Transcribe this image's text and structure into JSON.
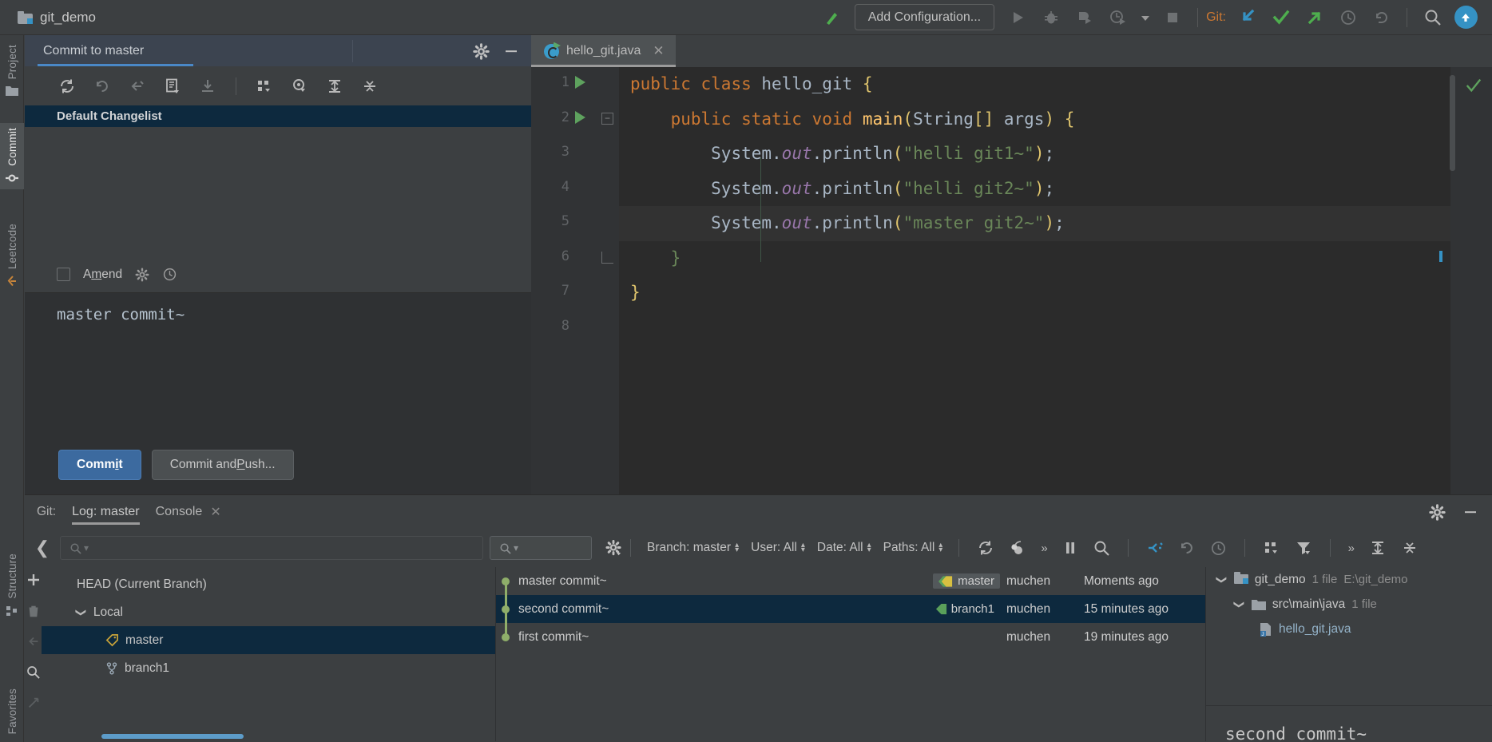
{
  "titlebar": {
    "project_name": "git_demo",
    "project_icon": "folder-module-icon",
    "run_config_label": "Add Configuration...",
    "git_label": "Git:",
    "icons": [
      {
        "name": "build-hammer-icon"
      },
      {
        "name": "run-icon"
      },
      {
        "name": "debug-icon"
      },
      {
        "name": "run-with-coverage-icon"
      },
      {
        "name": "profiler-icon"
      },
      {
        "name": "dropdown-caret-icon"
      },
      {
        "name": "stop-icon"
      },
      {
        "name": "git-update-project-icon"
      },
      {
        "name": "git-commit-icon"
      },
      {
        "name": "git-push-icon"
      },
      {
        "name": "git-history-icon"
      },
      {
        "name": "git-rollback-icon"
      },
      {
        "name": "search-everywhere-icon"
      },
      {
        "name": "ide-update-icon"
      }
    ]
  },
  "left_stripe": {
    "tabs": [
      {
        "label": "Project",
        "icon": "project-folder-icon",
        "selected": false
      },
      {
        "label": "Commit",
        "icon": "commit-icon",
        "selected": true
      },
      {
        "label": "Leetcode",
        "icon": "leetcode-icon",
        "selected": false
      }
    ],
    "bottom_tabs": [
      {
        "label": "Structure",
        "icon": "structure-icon",
        "selected": false
      },
      {
        "label": "Favorites",
        "icon": "favorites-icon",
        "selected": false
      }
    ]
  },
  "commit_window": {
    "title": "Commit to master",
    "settings_icon": "gear-icon",
    "minimize_icon": "minimize-icon",
    "toolbar_icons": [
      {
        "name": "refresh-changes-icon"
      },
      {
        "name": "rollback-icon"
      },
      {
        "name": "move-to-another-changelist-icon"
      },
      {
        "name": "show-diff-icon"
      },
      {
        "name": "shelve-changes-icon"
      },
      {
        "name": "group-by-icon"
      },
      {
        "name": "preview-diff-icon"
      },
      {
        "name": "expand-all-icon"
      },
      {
        "name": "collapse-all-icon"
      }
    ],
    "changelist_name": "Default Changelist",
    "amend_label": "Amend",
    "amend_checked": false,
    "amend_gear_icon": "gear-icon",
    "amend_history_icon": "history-icon",
    "commit_message": "master commit~",
    "commit_button": "Commit",
    "commit_push_button": "Commit and Push..."
  },
  "editor": {
    "tab": {
      "filename": "hello_git.java",
      "icon": "java-class-icon",
      "close_icon": "close-icon"
    },
    "inspection_status_icon": "inspections-ok-icon",
    "lines": [
      {
        "n": "1",
        "run": true,
        "fold": false,
        "highlight": false,
        "tokens": [
          {
            "t": "public ",
            "c": "k"
          },
          {
            "t": "class ",
            "c": "k"
          },
          {
            "t": "hello_git ",
            "c": "cls"
          },
          {
            "t": "{",
            "c": "br"
          }
        ]
      },
      {
        "n": "2",
        "run": true,
        "fold": true,
        "highlight": false,
        "tokens": [
          {
            "t": "    ",
            "c": "p"
          },
          {
            "t": "public ",
            "c": "k"
          },
          {
            "t": "static ",
            "c": "k"
          },
          {
            "t": "void ",
            "c": "k"
          },
          {
            "t": "main",
            "c": "mth"
          },
          {
            "t": "(",
            "c": "br"
          },
          {
            "t": "String",
            "c": "cls"
          },
          {
            "t": "[]",
            "c": "br"
          },
          {
            "t": " args",
            "c": "cls"
          },
          {
            "t": ")",
            "c": "br"
          },
          {
            "t": " {",
            "c": "br"
          }
        ]
      },
      {
        "n": "3",
        "run": false,
        "fold": false,
        "highlight": false,
        "tokens": [
          {
            "t": "        ",
            "c": "p"
          },
          {
            "t": "System",
            "c": "cls"
          },
          {
            "t": ".",
            "c": "p"
          },
          {
            "t": "out",
            "c": "fld"
          },
          {
            "t": ".",
            "c": "p"
          },
          {
            "t": "println",
            "c": "cls"
          },
          {
            "t": "(",
            "c": "br"
          },
          {
            "t": "\"helli git1~\"",
            "c": "s"
          },
          {
            "t": ")",
            "c": "br"
          },
          {
            "t": ";",
            "c": "p"
          }
        ]
      },
      {
        "n": "4",
        "run": false,
        "fold": false,
        "highlight": false,
        "tokens": [
          {
            "t": "        ",
            "c": "p"
          },
          {
            "t": "System",
            "c": "cls"
          },
          {
            "t": ".",
            "c": "p"
          },
          {
            "t": "out",
            "c": "fld"
          },
          {
            "t": ".",
            "c": "p"
          },
          {
            "t": "println",
            "c": "cls"
          },
          {
            "t": "(",
            "c": "br"
          },
          {
            "t": "\"helli git2~\"",
            "c": "s"
          },
          {
            "t": ")",
            "c": "br"
          },
          {
            "t": ";",
            "c": "p"
          }
        ]
      },
      {
        "n": "5",
        "run": false,
        "fold": false,
        "highlight": true,
        "tokens": [
          {
            "t": "        ",
            "c": "p"
          },
          {
            "t": "System",
            "c": "cls"
          },
          {
            "t": ".",
            "c": "p"
          },
          {
            "t": "out",
            "c": "fld"
          },
          {
            "t": ".",
            "c": "p"
          },
          {
            "t": "println",
            "c": "cls"
          },
          {
            "t": "(",
            "c": "br"
          },
          {
            "t": "\"master git2~\"",
            "c": "s"
          },
          {
            "t": ")",
            "c": "br"
          },
          {
            "t": ";",
            "c": "p"
          }
        ]
      },
      {
        "n": "6",
        "run": false,
        "fold": "end",
        "highlight": false,
        "tokens": [
          {
            "t": "    ",
            "c": "p"
          },
          {
            "t": "}",
            "c": "brk"
          }
        ]
      },
      {
        "n": "7",
        "run": false,
        "fold": false,
        "highlight": false,
        "tokens": [
          {
            "t": "}",
            "c": "br"
          }
        ]
      },
      {
        "n": "8",
        "run": false,
        "fold": false,
        "highlight": false,
        "tokens": []
      }
    ]
  },
  "git_panel": {
    "label": "Git:",
    "tabs": [
      {
        "label": "Log: master",
        "selected": true,
        "closable": false
      },
      {
        "label": "Console",
        "selected": false,
        "closable": true,
        "close_icon": "close-icon"
      }
    ],
    "settings_icon": "gear-icon",
    "hide_icon": "minimize-icon",
    "collapse_icon": "collapse-left-icon",
    "branch_search_placeholder": "",
    "branch_search_icon": "search-icon",
    "log_search_placeholder": "",
    "log_search_icon": "search-icon",
    "log_settings_icon": "gear-icon",
    "filters": [
      {
        "label": "Branch: master",
        "name": "branch-filter"
      },
      {
        "label": "User: All",
        "name": "user-filter"
      },
      {
        "label": "Date: All",
        "name": "date-filter"
      },
      {
        "label": "Paths: All",
        "name": "paths-filter"
      }
    ],
    "toolbar_icons": [
      {
        "name": "refresh-icon"
      },
      {
        "name": "git-cherry-pick-icon"
      },
      {
        "name": "more-actions-icon"
      },
      {
        "name": "pause-icon"
      },
      {
        "name": "search-icon"
      },
      {
        "name": "highlight-my-commits-icon"
      },
      {
        "name": "revert-icon"
      },
      {
        "name": "show-history-icon"
      },
      {
        "name": "group-by-icon"
      },
      {
        "name": "filter-icon"
      },
      {
        "name": "more-actions-icon"
      },
      {
        "name": "expand-all-icon"
      },
      {
        "name": "collapse-all-icon"
      }
    ],
    "branch_tree": [
      {
        "label": "HEAD (Current Branch)",
        "indent": 0,
        "icon": null,
        "chevron": null,
        "selected": false
      },
      {
        "label": "Local",
        "indent": 0,
        "icon": null,
        "chevron": "down",
        "selected": false
      },
      {
        "label": "master",
        "indent": 1,
        "icon": "branch-tag-icon",
        "chevron": null,
        "selected": true
      },
      {
        "label": "branch1",
        "indent": 1,
        "icon": "branch-icon",
        "chevron": null,
        "selected": false
      }
    ],
    "commits": [
      {
        "subject": "master commit~",
        "ref": "master",
        "ref_style": "current",
        "author": "muchen",
        "date": "Moments ago",
        "selected": false
      },
      {
        "subject": "second commit~",
        "ref": "branch1",
        "ref_style": "branch",
        "author": "muchen",
        "date": "15 minutes ago",
        "selected": true
      },
      {
        "subject": "first commit~",
        "ref": null,
        "ref_style": null,
        "author": "muchen",
        "date": "19 minutes ago",
        "selected": false
      }
    ],
    "changed_files": [
      {
        "label": "git_demo",
        "meta": "1 file",
        "path": "E:\\git_demo",
        "indent": 0,
        "chevron": "down",
        "icon": "folder-module-icon"
      },
      {
        "label": "src\\main\\java",
        "meta": "1 file",
        "path": "",
        "indent": 1,
        "chevron": "down",
        "icon": "folder-icon"
      },
      {
        "label": "hello_git.java",
        "meta": "",
        "path": "",
        "indent": 2,
        "chevron": null,
        "icon": "java-file-icon"
      }
    ],
    "detail_message": "second commit~"
  }
}
